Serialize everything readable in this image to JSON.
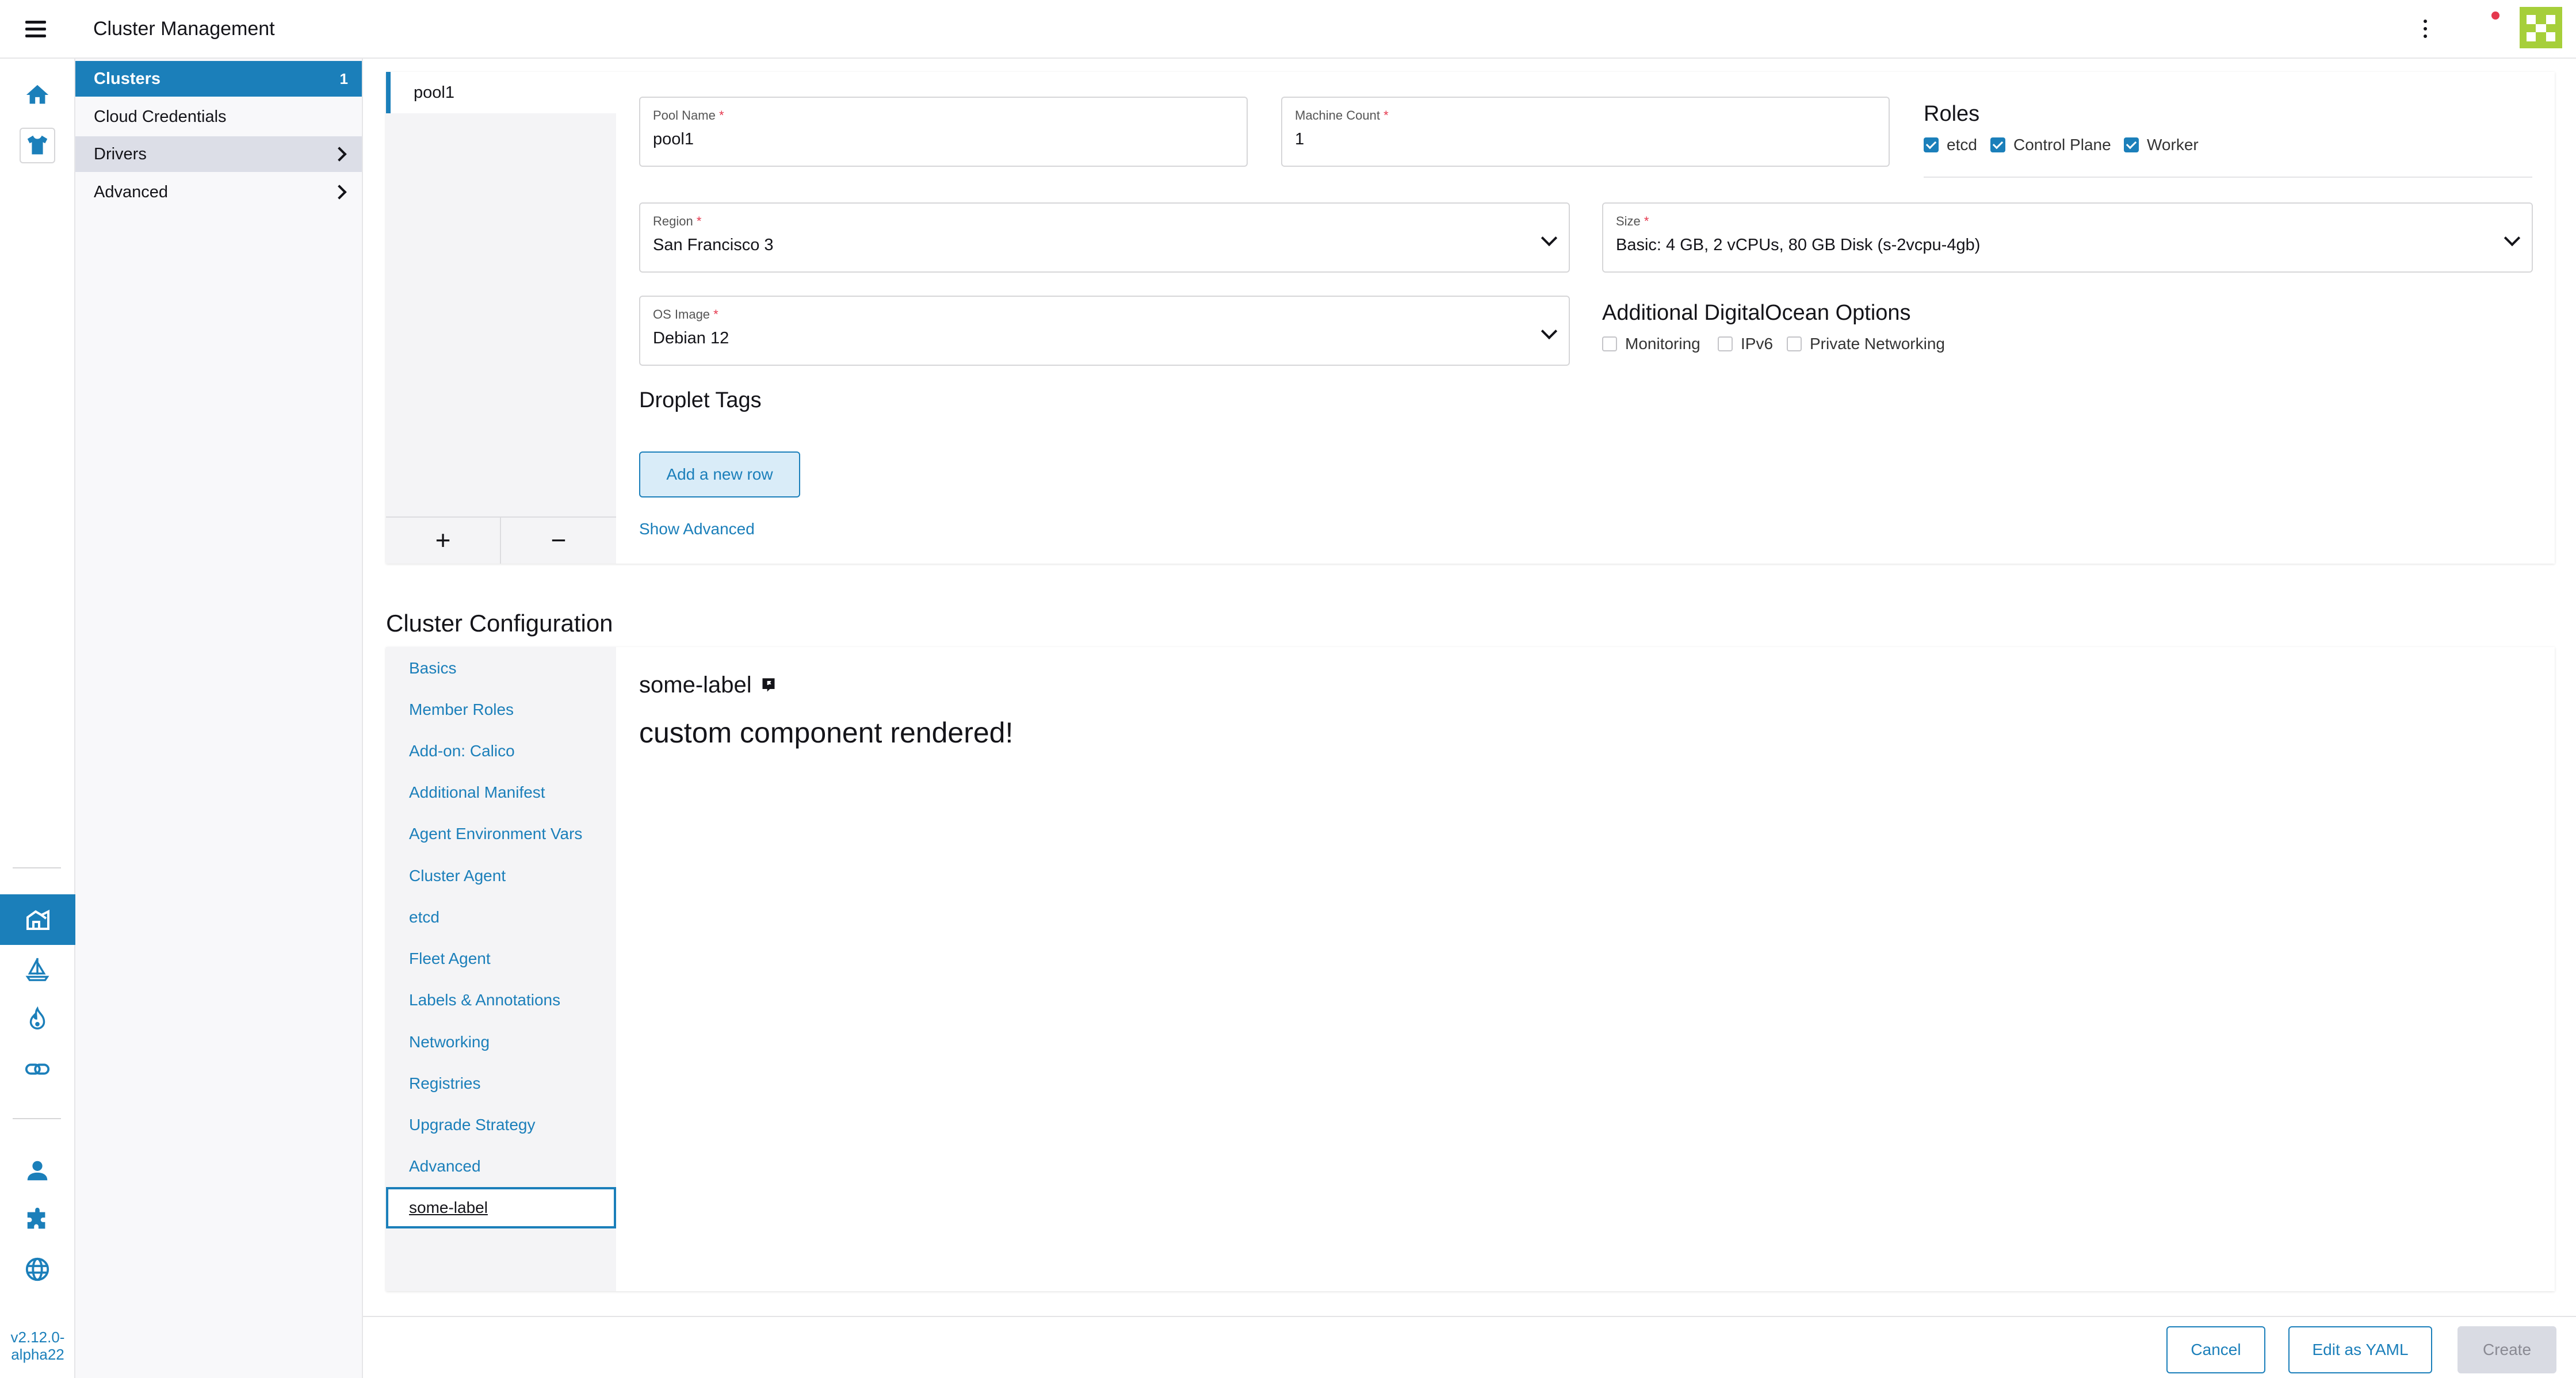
{
  "header": {
    "title": "Cluster Management",
    "menu_icon": "hamburger-menu-icon",
    "more_icon": "kebab-menu-icon",
    "notification_color": "#e5384e",
    "avatar_color": "#a6cf3a"
  },
  "rail": {
    "version": "v2.12.0-alpha22",
    "top_icons": [
      "home-icon",
      "shirt-icon"
    ],
    "active_icon": "cluster-management-icon",
    "mid_icons": [
      "sailboat-icon",
      "flame-icon",
      "chain-link-icon"
    ],
    "bottom_icons": [
      "user-icon",
      "puzzle-icon",
      "globe-icon"
    ]
  },
  "sidenav": {
    "items": [
      {
        "label": "Clusters",
        "count": "1"
      },
      {
        "label": "Cloud Credentials"
      },
      {
        "label": "Drivers"
      },
      {
        "label": "Advanced"
      }
    ]
  },
  "pools": {
    "tabs": [
      "pool1"
    ],
    "add_label": "+",
    "remove_label": "−"
  },
  "pool_form": {
    "pool_name": {
      "label": "Pool Name",
      "required": "*",
      "value": "pool1"
    },
    "machine_count": {
      "label": "Machine Count",
      "required": "*",
      "value": "1"
    },
    "roles": {
      "title": "Roles",
      "options": [
        {
          "label": "etcd",
          "checked": true
        },
        {
          "label": "Control Plane",
          "checked": true
        },
        {
          "label": "Worker",
          "checked": true
        }
      ]
    },
    "region": {
      "label": "Region",
      "required": "*",
      "value": "San Francisco 3"
    },
    "size": {
      "label": "Size",
      "required": "*",
      "value": "Basic: 4 GB, 2 vCPUs, 80 GB Disk (s-2vcpu-4gb)"
    },
    "os_image": {
      "label": "OS Image",
      "required": "*",
      "value": "Debian 12"
    },
    "additional_options": {
      "title": "Additional DigitalOcean Options",
      "options": [
        {
          "label": "Monitoring",
          "checked": false
        },
        {
          "label": "IPv6",
          "checked": false
        },
        {
          "label": "Private Networking",
          "checked": false
        }
      ]
    },
    "droplet_tags": {
      "title": "Droplet Tags",
      "add_row_label": "Add a new row"
    },
    "show_advanced_label": "Show Advanced"
  },
  "cluster_config": {
    "title": "Cluster Configuration",
    "tabs": [
      "Basics",
      "Member Roles",
      "Add-on: Calico",
      "Additional Manifest",
      "Agent Environment Vars",
      "Cluster Agent",
      "etcd",
      "Fleet Agent",
      "Labels & Annotations",
      "Networking",
      "Registries",
      "Upgrade Strategy",
      "Advanced",
      "some-label"
    ],
    "active_tab": "some-label",
    "content_label": "some-label",
    "content_icon": "flag-icon",
    "content_text": "custom component rendered!"
  },
  "footer": {
    "cancel_label": "Cancel",
    "yaml_label": "Edit as YAML",
    "create_label": "Create"
  },
  "colors": {
    "accent": "#1b7fba",
    "required": "#e5384e",
    "active_nav_bg": "#1b7fba",
    "hover_nav_bg": "#dcdee7"
  }
}
